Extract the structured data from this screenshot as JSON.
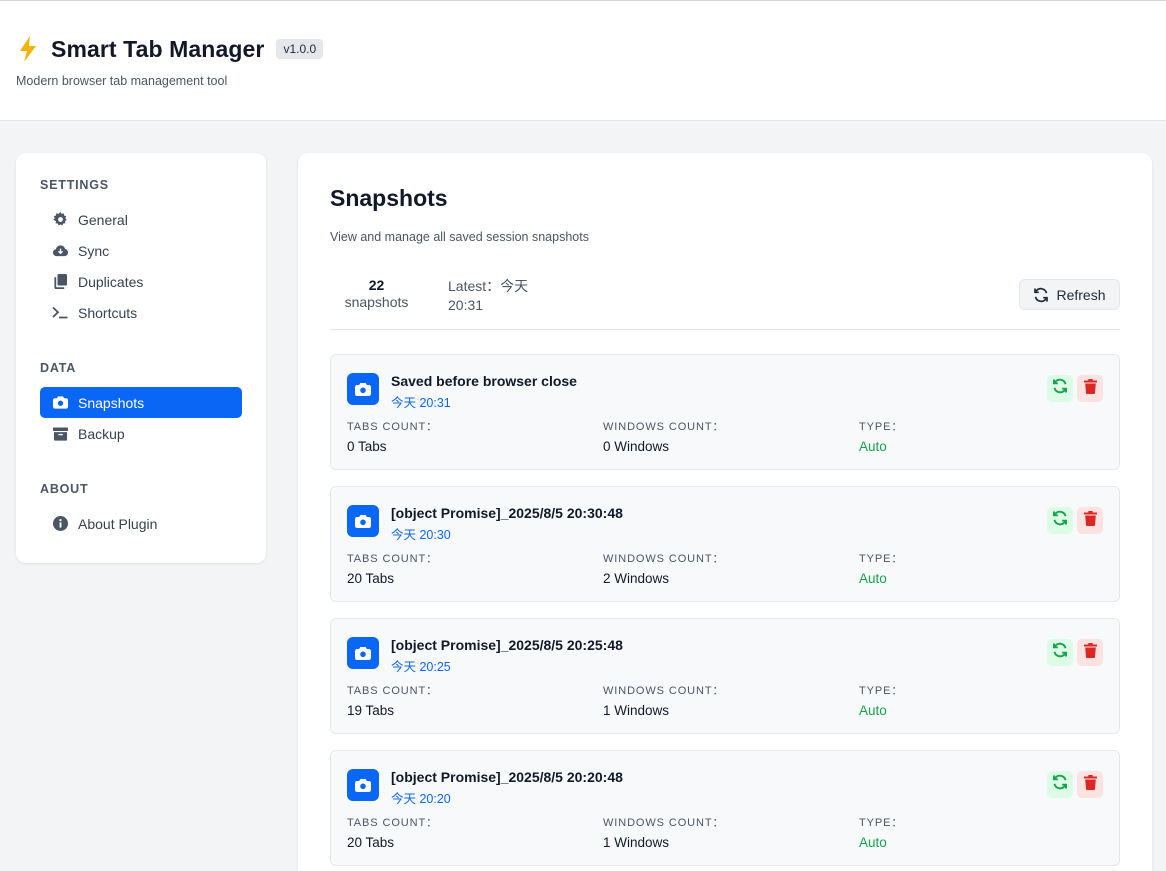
{
  "header": {
    "title": "Smart Tab Manager",
    "version": "v1.0.0",
    "subtitle": "Modern browser tab management tool"
  },
  "sidebar": {
    "sections": [
      {
        "title": "SETTINGS",
        "items": [
          {
            "label": "General",
            "icon": "gear-icon"
          },
          {
            "label": "Sync",
            "icon": "cloud-icon"
          },
          {
            "label": "Duplicates",
            "icon": "copy-icon"
          },
          {
            "label": "Shortcuts",
            "icon": "terminal-icon"
          }
        ]
      },
      {
        "title": "DATA",
        "items": [
          {
            "label": "Snapshots",
            "icon": "camera-icon",
            "active": true
          },
          {
            "label": "Backup",
            "icon": "archive-icon"
          }
        ]
      },
      {
        "title": "ABOUT",
        "items": [
          {
            "label": "About Plugin",
            "icon": "info-icon"
          }
        ]
      }
    ]
  },
  "main": {
    "title": "Snapshots",
    "description": "View and manage all saved session snapshots",
    "stats": {
      "count": "22",
      "count_label": "snapshots",
      "latest_label": "Latest：今天 20:31"
    },
    "refresh_label": "Refresh",
    "meta_labels": {
      "tabs": "TABS COUNT：",
      "windows": "WINDOWS COUNT：",
      "type": "TYPE："
    },
    "snapshots": [
      {
        "title": "Saved before browser close",
        "time": "今天 20:31",
        "tabs": "0 Tabs",
        "windows": "0 Windows",
        "type": "Auto"
      },
      {
        "title": "[object Promise]_2025/8/5 20:30:48",
        "time": "今天 20:30",
        "tabs": "20 Tabs",
        "windows": "2 Windows",
        "type": "Auto"
      },
      {
        "title": "[object Promise]_2025/8/5 20:25:48",
        "time": "今天 20:25",
        "tabs": "19 Tabs",
        "windows": "1 Windows",
        "type": "Auto"
      },
      {
        "title": "[object Promise]_2025/8/5 20:20:48",
        "time": "今天 20:20",
        "tabs": "20 Tabs",
        "windows": "1 Windows",
        "type": "Auto"
      }
    ]
  },
  "colors": {
    "accent": "#0a66f5",
    "success": "#16a34a",
    "danger": "#dc2626"
  }
}
